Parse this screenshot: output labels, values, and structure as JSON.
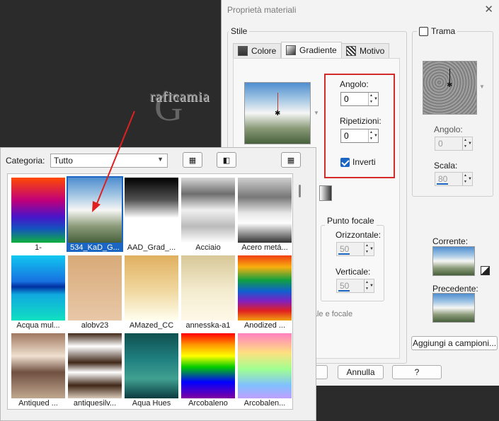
{
  "dialog": {
    "title": "Proprietà materiali",
    "close_glyph": "✕",
    "stile_label": "Stile",
    "tabs": [
      {
        "label": "Colore",
        "icon": "color-swatch-icon"
      },
      {
        "label": "Gradiente",
        "icon": "gradient-icon"
      },
      {
        "label": "Motivo",
        "icon": "pattern-icon"
      }
    ],
    "angolo_label": "Angolo:",
    "angolo_value": "0",
    "ripetizioni_label": "Ripetizioni:",
    "ripetizioni_value": "0",
    "inverti_label": "Inverti",
    "inverti_checked": true,
    "punto_focale_label": "Punto focale",
    "orizzontale_label": "Orizzontale:",
    "orizzontale_value": "50",
    "verticale_label": "Verticale:",
    "verticale_value": "50",
    "centrale_focale_text": "ntrale e focale",
    "trama_label": "Trama",
    "trama_checked": false,
    "trama_angolo_label": "Angolo:",
    "trama_angolo_value": "0",
    "scala_label": "Scala:",
    "scala_value": "80",
    "corrente_label": "Corrente:",
    "precedente_label": "Precedente:",
    "aggiungi_button": "Aggiungi a campioni...",
    "annulla_button": "Annulla",
    "help_button": "?"
  },
  "picker": {
    "categoria_label": "Categoria:",
    "categoria_value": "Tutto",
    "tool_icons": [
      "preset-list-icon",
      "save-preset-icon",
      "view-options-icon"
    ],
    "items": [
      {
        "name": "1-",
        "gradient": "linear-gradient(180deg,#ff4a00 0%,#c0007a 35%,#4a14c8 60%,#1550c0 78%,#10b040 100%)",
        "selected": false
      },
      {
        "name": "534_KaD_G...",
        "gradient": "linear-gradient(180deg,#4f8ed0 0%,#a6c8e4 28%,#f6f6f4 50%,#8a9a78 75%,#47603b 100%)",
        "selected": true
      },
      {
        "name": "AAD_Grad_...",
        "gradient": "linear-gradient(180deg,#000 0%,#555 35%,#fff 62%,#fff 100%)",
        "selected": false
      },
      {
        "name": "Acciaio",
        "gradient": "linear-gradient(180deg,#d8d8d8 0%,#6e6e6e 25%,#f0f0f0 50%,#bbbbbb 75%,#ffffff 100%)",
        "selected": false
      },
      {
        "name": "Acero metá...",
        "gradient": "linear-gradient(180deg,#cfcfcf 0%,#777 30%,#e8e8e8 55%,#fdfdfd 70%,#333 100%)",
        "selected": false
      },
      {
        "name": "Acqua mul...",
        "gradient": "linear-gradient(180deg,#10c8f0 0%,#1870e0 40%,#0030a0 48%,#10a8e0 60%,#10e0c0 100%)",
        "selected": false
      },
      {
        "name": "alobv23",
        "gradient": "linear-gradient(180deg,#d8aa78 0%,#e8c8a8 100%)",
        "selected": false
      },
      {
        "name": "AMazed_CC",
        "gradient": "linear-gradient(180deg,#e0b060 0%,#f0d8a0 55%,#fffff0 100%)",
        "selected": false
      },
      {
        "name": "annesska-a1",
        "gradient": "linear-gradient(180deg,#d8c898 0%,#f4ecd0 55%,#fff8e8 100%)",
        "selected": false
      },
      {
        "name": "Anodized ...",
        "gradient": "linear-gradient(180deg,#f04010 0%,#f8b010 18%,#10a040 38%,#1060d0 55%,#8020c0 70%,#e02020 85%,#f0a010 100%)",
        "selected": false
      },
      {
        "name": "Antiqued ...",
        "gradient": "linear-gradient(180deg,#a07860 0%,#f0e0d0 35%,#705040 60%,#c0a890 100%)",
        "selected": false
      },
      {
        "name": "antiquesilv...",
        "gradient": "linear-gradient(180deg,#402818 0%,#fff 20%,#402818 45%,#fff 60%,#402818 80%,#d8c8b8 100%)",
        "selected": false
      },
      {
        "name": "Aqua Hues",
        "gradient": "linear-gradient(180deg,#105050 0%,#208080 40%,#40a090 70%,#0a3a40 100%)",
        "selected": false
      },
      {
        "name": "Arcobaleno",
        "gradient": "linear-gradient(180deg,#ff0000 0%,#ff9900 18%,#ffff00 35%,#00cc00 52%,#0000ff 75%,#8000a0 100%)",
        "selected": false
      },
      {
        "name": "Arcobalen...",
        "gradient": "linear-gradient(180deg,#ff80c0 0%,#ffe080 30%,#a0ff90 55%,#80c0ff 80%,#c0a0ff 100%)",
        "selected": false
      }
    ]
  },
  "watermark": {
    "initial": "G",
    "text": "raficamia"
  }
}
